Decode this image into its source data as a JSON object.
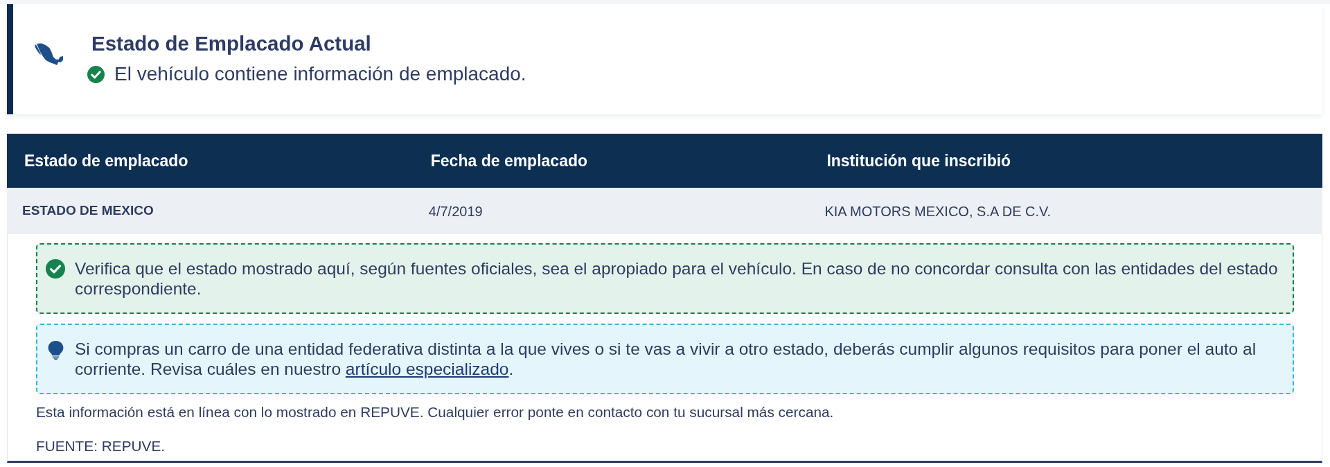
{
  "status_card": {
    "title": "Estado de Emplacado Actual",
    "message": "El vehículo contiene información de emplacado."
  },
  "table": {
    "columns": [
      "Estado de emplacado",
      "Fecha de emplacado",
      "Institución que inscribió"
    ],
    "rows": [
      [
        "ESTADO DE MEXICO",
        "4/7/2019",
        "KIA MOTORS MEXICO, S.A DE C.V."
      ]
    ]
  },
  "notices": [
    {
      "kind": "success",
      "text": "Verifica que el estado mostrado aquí, según fuentes oficiales, sea el apropiado para el vehículo. En caso de no concordar consulta con las entidades del estado correspondiente."
    },
    {
      "kind": "tip",
      "text": "Si compras un carro de una entidad federativa distinta a la que vives o si te vas a vivir a otro estado, deberás cumplir algunos requisitos para poner el auto al corriente. Revisa cuáles en nuestro ",
      "link": "artículo especializado",
      "text_after": "."
    }
  ],
  "footnotes": [
    "Esta información está en línea con lo mostrado en REPUVE. Cualquier error ponte en contacto con tu sucursal más cercana.",
    "FUENTE: REPUVE."
  ]
}
